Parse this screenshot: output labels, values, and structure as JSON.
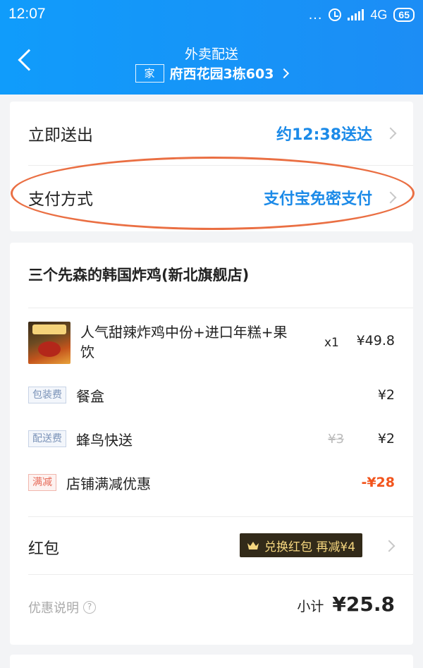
{
  "status_bar": {
    "time": "12:07",
    "dots": "...",
    "network": "4G",
    "battery": "65"
  },
  "header": {
    "title": "外卖配送",
    "address_tag": "家",
    "address": "府西花园3栋603"
  },
  "delivery": {
    "time_label": "立即送出",
    "time_value": "约12:38送达",
    "payment_label": "支付方式",
    "payment_value": "支付宝免密支付"
  },
  "order": {
    "shop_name": "三个先森的韩国炸鸡(新北旗舰店)",
    "items": [
      {
        "name": "人气甜辣炸鸡中份+进口年糕+果饮",
        "qty": "x1",
        "price": "¥49.8"
      }
    ],
    "fees": [
      {
        "tag": "包装费",
        "label": "餐盒",
        "original": "",
        "amount": "¥2"
      },
      {
        "tag": "配送费",
        "label": "蜂鸟快送",
        "original": "¥3",
        "amount": "¥2"
      },
      {
        "tag": "满减",
        "label": "店铺满减优惠",
        "original": "",
        "amount": "-¥28"
      }
    ],
    "red_packet_label": "红包",
    "red_packet_badge": "兑换红包 再减¥4",
    "discount_info_label": "优惠说明",
    "subtotal_label": "小计",
    "subtotal_value": "¥25.8"
  },
  "colors": {
    "header_blue": "#1c8df5",
    "link_blue": "#1b8ae8",
    "highlight_orange": "#ea6f43",
    "discount_red": "#f2541c"
  }
}
